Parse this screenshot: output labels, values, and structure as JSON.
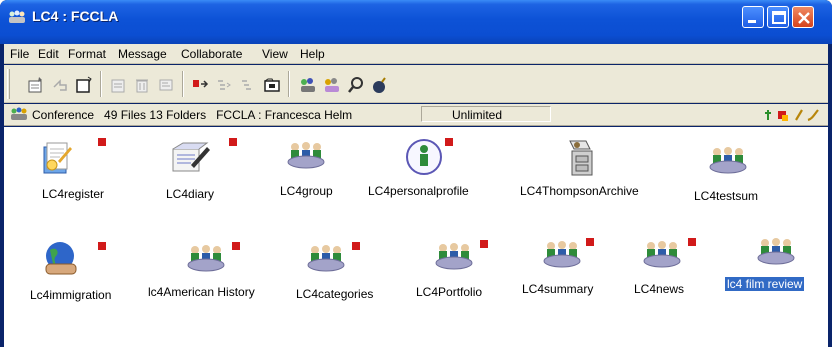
{
  "window": {
    "title": "LC4 : FCCLA",
    "icon": "conference-icon"
  },
  "menu": {
    "items": [
      "File",
      "Edit",
      "Format",
      "Message",
      "Collaborate",
      "View",
      "Help"
    ]
  },
  "status": {
    "text": "Conference   49 Files 13 Folders   FCCLA : Francesca Helm",
    "storage": "Unlimited"
  },
  "items": [
    {
      "label": "LC4register",
      "icon": "register-form-icon",
      "flag": true
    },
    {
      "label": "LC4diary",
      "icon": "diary-notepad-icon",
      "flag": true
    },
    {
      "label": "LC4group",
      "icon": "group-people-icon",
      "flag": false
    },
    {
      "label": "LC4personalprofile",
      "icon": "personal-profile-icon",
      "flag": true
    },
    {
      "label": "LC4ThompsonArchive",
      "icon": "archive-cabinet-icon",
      "flag": false
    },
    {
      "label": "LC4testsum",
      "icon": "group-people-icon",
      "flag": false
    },
    {
      "label": "Lc4immigration",
      "icon": "globe-handshake-icon",
      "flag": true
    },
    {
      "label": "lc4American History",
      "icon": "group-people-icon",
      "flag": true
    },
    {
      "label": "LC4categories",
      "icon": "group-people-icon",
      "flag": true
    },
    {
      "label": "LC4Portfolio",
      "icon": "group-people-icon",
      "flag": true
    },
    {
      "label": "LC4summary",
      "icon": "group-people-icon",
      "flag": true
    },
    {
      "label": "LC4news",
      "icon": "group-people-icon",
      "flag": true
    },
    {
      "label": "lc4 film review",
      "icon": "group-people-icon",
      "flag": false,
      "selected": true
    }
  ],
  "colors": {
    "titlebar": "#0b4ed2",
    "chrome": "#ece9d8",
    "selection": "#316ac5",
    "flag": "#d11a1a"
  }
}
